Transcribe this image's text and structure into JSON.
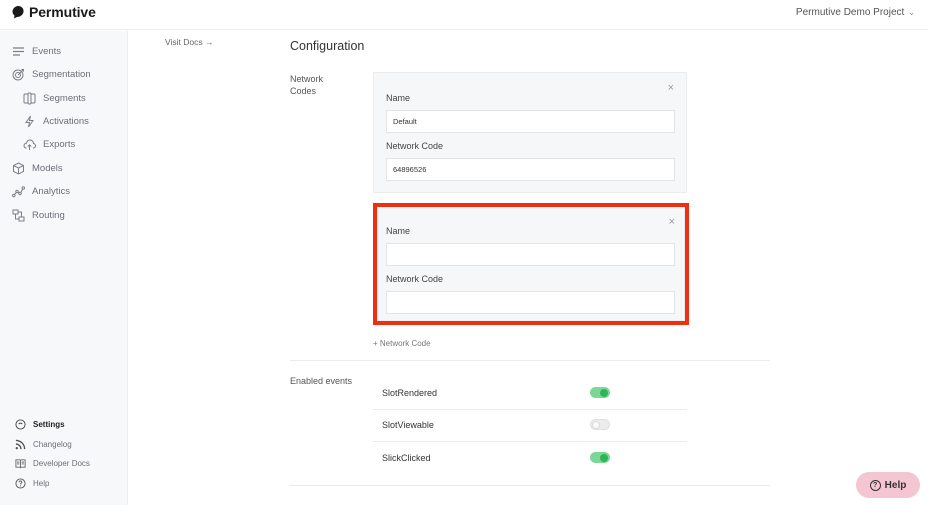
{
  "app": {
    "name": "Permutive",
    "project": "Permutive Demo Project"
  },
  "sidebar": {
    "items": [
      {
        "label": "Events",
        "icon": "list-icon"
      },
      {
        "label": "Segmentation",
        "icon": "target-icon"
      },
      {
        "label": "Segments",
        "icon": "segments-icon"
      },
      {
        "label": "Activations",
        "icon": "bolt-icon"
      },
      {
        "label": "Exports",
        "icon": "cloud-upload-icon"
      },
      {
        "label": "Models",
        "icon": "cube-icon"
      },
      {
        "label": "Analytics",
        "icon": "analytics-icon"
      },
      {
        "label": "Routing",
        "icon": "routing-icon"
      }
    ],
    "bottom": [
      {
        "label": "Settings",
        "icon": "settings-icon"
      },
      {
        "label": "Changelog",
        "icon": "rss-icon"
      },
      {
        "label": "Developer Docs",
        "icon": "book-icon"
      },
      {
        "label": "Help",
        "icon": "help-icon"
      }
    ]
  },
  "page": {
    "visit_docs": "Visit Docs →",
    "title": "Configuration",
    "network_codes_label": "Network Codes",
    "enabled_events_label": "Enabled events",
    "add_network_code": "+ Network Code"
  },
  "network_codes": [
    {
      "name_label": "Name",
      "name_value": "Default",
      "code_label": "Network Code",
      "code_value": "64896526"
    },
    {
      "name_label": "Name",
      "name_value": "",
      "code_label": "Network Code",
      "code_value": ""
    }
  ],
  "events": [
    {
      "name": "SlotRendered",
      "enabled": true
    },
    {
      "name": "SlotViewable",
      "enabled": false
    },
    {
      "name": "SlickClicked",
      "enabled": true
    }
  ],
  "help_button": {
    "label": "Help"
  },
  "colors": {
    "highlight": "#ef2f12",
    "toggle_on": "#2fb654",
    "help_bg": "#f4c6d2"
  }
}
